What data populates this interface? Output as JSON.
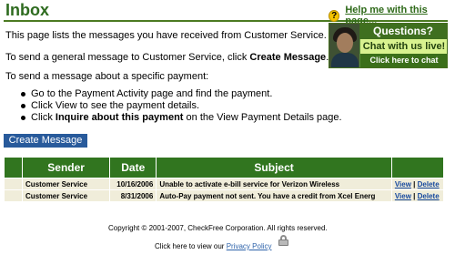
{
  "page": {
    "title": "Inbox",
    "help_link": "Help me with this page...",
    "help_icon": "question-icon"
  },
  "intro": {
    "line1": "This page lists the messages you have received from Customer Service.",
    "line2_prefix": "To send a general message to Customer Service, click ",
    "line2_bold": "Create Message",
    "line2_suffix": ".",
    "line3": "To send a message about a specific payment:",
    "steps": [
      "Go to the Payment Activity page and find the payment.",
      "Click View to see the payment details."
    ],
    "step3_prefix": "Click ",
    "step3_bold": "Inquire about this payment",
    "step3_suffix": " on the View Payment Details page."
  },
  "chat_ad": {
    "questions": "Questions?",
    "chat": "Chat with us live!",
    "click": "Click here to chat"
  },
  "actions": {
    "create_message": "Create Message"
  },
  "table": {
    "headers": [
      "Sender",
      "Date",
      "Subject",
      ""
    ],
    "rows": [
      {
        "sender": "Customer Service",
        "date": "10/16/2006",
        "subject": "Unable to activate e-bill service for Verizon Wireless",
        "view": "View",
        "separator": "|",
        "delete": "Delete"
      },
      {
        "sender": "Customer Service",
        "date": "8/31/2006",
        "subject": "Auto-Pay payment not sent. You have a credit from Xcel Energ",
        "view": "View",
        "separator": "|",
        "delete": "Delete"
      }
    ]
  },
  "footer": {
    "copyright": "Copyright © 2001-2007, CheckFree Corporation. All rights reserved.",
    "privacy_prefix": "Click here to view our ",
    "privacy_link": "Privacy Policy",
    "privacy_icon": "lock-icon"
  },
  "colors": {
    "brand_green": "#2e6b1f",
    "table_header_green": "#31751f",
    "button_blue": "#285a9b",
    "link_blue": "#14479d"
  }
}
